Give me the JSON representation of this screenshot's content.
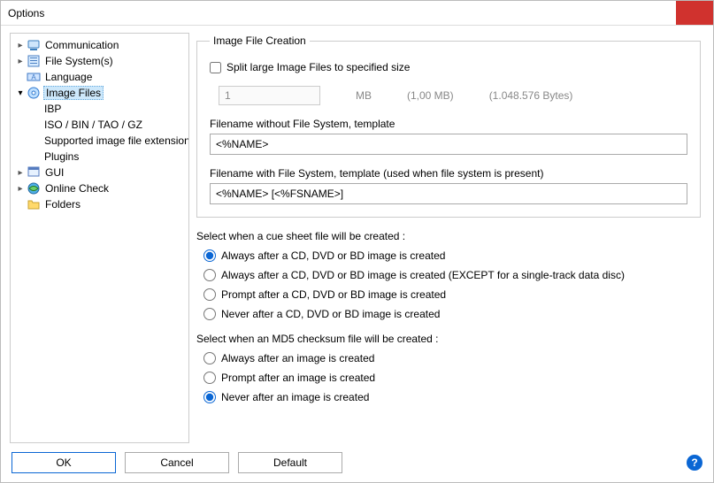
{
  "window": {
    "title": "Options"
  },
  "tree": {
    "communication": "Communication",
    "filesystems": "File System(s)",
    "language": "Language",
    "imagefiles": "Image Files",
    "ibp": "IBP",
    "iso": "ISO / BIN / TAO / GZ",
    "supported": "Supported image file extension",
    "plugins": "Plugins",
    "gui": "GUI",
    "onlinecheck": "Online Check",
    "folders": "Folders"
  },
  "group": {
    "legend": "Image File Creation",
    "split_label": "Split large Image Files to specified size",
    "split_value": "1",
    "split_unit": "MB",
    "split_hint1": "(1,00 MB)",
    "split_hint2": "(1.048.576 Bytes)",
    "tpl_nofs_label": "Filename without File System, template",
    "tpl_nofs_value": "<%NAME>",
    "tpl_fs_label": "Filename with File System, template (used when file system is present)",
    "tpl_fs_value": "<%NAME> [<%FSNAME>]"
  },
  "cue": {
    "title": "Select when a cue sheet file will be created :",
    "opt1": "Always after a CD, DVD or BD image is created",
    "opt2": "Always after a CD, DVD or BD image is created (EXCEPT for a single-track data disc)",
    "opt3": "Prompt after a CD, DVD or BD image is created",
    "opt4": "Never after a CD, DVD or BD image is created"
  },
  "md5": {
    "title": "Select when an MD5 checksum file will be created :",
    "opt1": "Always after an image is created",
    "opt2": "Prompt after an image is created",
    "opt3": "Never after an image is created"
  },
  "buttons": {
    "ok": "OK",
    "cancel": "Cancel",
    "default": "Default"
  }
}
